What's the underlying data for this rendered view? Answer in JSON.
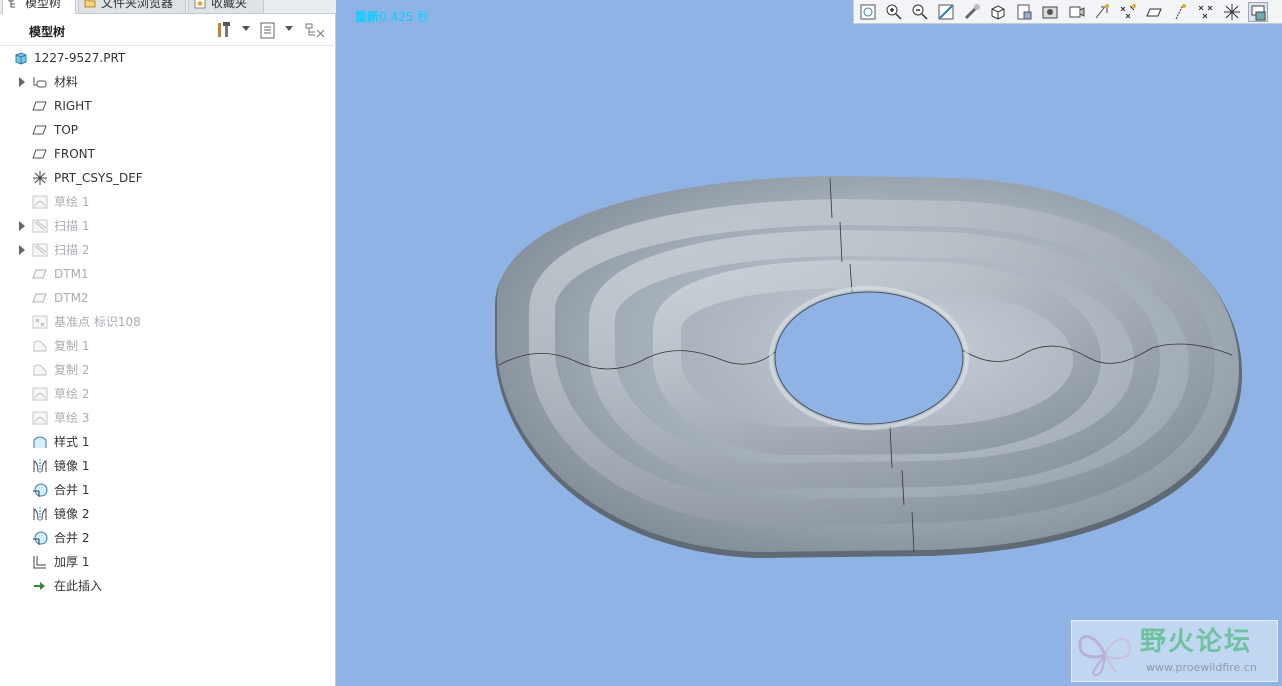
{
  "tabs": [
    {
      "label": "模型树",
      "icon": "model-tree-icon",
      "active": true
    },
    {
      "label": "文件夹浏览器",
      "icon": "folder-icon",
      "active": false
    },
    {
      "label": "收藏夹",
      "icon": "favorites-icon",
      "active": false
    }
  ],
  "tree_header": {
    "title": "模型树",
    "settings_icon": "tools-icon",
    "display_icon": "list-view-icon",
    "filter_icon": "tree-filter-icon"
  },
  "tree": {
    "root": {
      "label": "1227-9527.PRT",
      "icon": "part-icon"
    },
    "items": [
      {
        "label": "材料",
        "icon": "material-icon",
        "expandable": true,
        "dim": false
      },
      {
        "label": "RIGHT",
        "icon": "datum-plane-icon",
        "expandable": false,
        "dim": false
      },
      {
        "label": "TOP",
        "icon": "datum-plane-icon",
        "expandable": false,
        "dim": false
      },
      {
        "label": "FRONT",
        "icon": "datum-plane-icon",
        "expandable": false,
        "dim": false
      },
      {
        "label": "PRT_CSYS_DEF",
        "icon": "coordinate-system-icon",
        "expandable": false,
        "dim": false
      },
      {
        "label": "草绘 1",
        "icon": "sketch-icon",
        "expandable": false,
        "dim": true
      },
      {
        "label": "扫描 1",
        "icon": "sweep-icon",
        "expandable": true,
        "dim": true
      },
      {
        "label": "扫描 2",
        "icon": "sweep-icon",
        "expandable": true,
        "dim": true
      },
      {
        "label": "DTM1",
        "icon": "datum-plane-icon",
        "expandable": false,
        "dim": true
      },
      {
        "label": "DTM2",
        "icon": "datum-plane-icon",
        "expandable": false,
        "dim": true
      },
      {
        "label": "基准点 标识108",
        "icon": "datum-point-icon",
        "expandable": false,
        "dim": true
      },
      {
        "label": "复制 1",
        "icon": "copy-icon",
        "expandable": false,
        "dim": true
      },
      {
        "label": "复制 2",
        "icon": "copy-icon",
        "expandable": false,
        "dim": true
      },
      {
        "label": "草绘 2",
        "icon": "sketch-icon",
        "expandable": false,
        "dim": true
      },
      {
        "label": "草绘 3",
        "icon": "sketch-icon",
        "expandable": false,
        "dim": true
      },
      {
        "label": "样式 1",
        "icon": "style-icon",
        "expandable": false,
        "dim": false
      },
      {
        "label": "镜像 1",
        "icon": "mirror-icon",
        "expandable": false,
        "dim": false
      },
      {
        "label": "合并 1",
        "icon": "merge-icon",
        "expandable": false,
        "dim": false
      },
      {
        "label": "镜像 2",
        "icon": "mirror-icon",
        "expandable": false,
        "dim": false
      },
      {
        "label": "合并 2",
        "icon": "merge-icon",
        "expandable": false,
        "dim": false
      },
      {
        "label": "加厚 1",
        "icon": "thicken-icon",
        "expandable": false,
        "dim": false
      },
      {
        "label": "在此插入",
        "icon": "insert-here-arrow-icon",
        "expandable": false,
        "dim": false
      }
    ]
  },
  "viewport": {
    "status_bold": "重新",
    "status_text": "0.425 秒",
    "background_color": "#8fb3e4",
    "toolbar": [
      {
        "name": "refit-icon"
      },
      {
        "name": "zoom-in-icon"
      },
      {
        "name": "zoom-out-icon"
      },
      {
        "name": "repaint-icon"
      },
      {
        "name": "spin-center-icon"
      },
      {
        "name": "display-style-icon"
      },
      {
        "name": "saved-views-icon"
      },
      {
        "name": "view-manager-icon"
      },
      {
        "name": "layers-icon"
      },
      {
        "name": "annotations-icon"
      },
      {
        "name": "datum-display-icon"
      },
      {
        "name": "plane-display-icon"
      },
      {
        "name": "axis-display-icon"
      },
      {
        "name": "point-display-icon"
      },
      {
        "name": "csys-display-icon"
      },
      {
        "name": "appearance-icon"
      }
    ]
  },
  "watermark": {
    "title": "野火论坛",
    "url": "www.proewildfire.cn",
    "logo": "butterfly-logo",
    "color": "#6fc2a0"
  }
}
